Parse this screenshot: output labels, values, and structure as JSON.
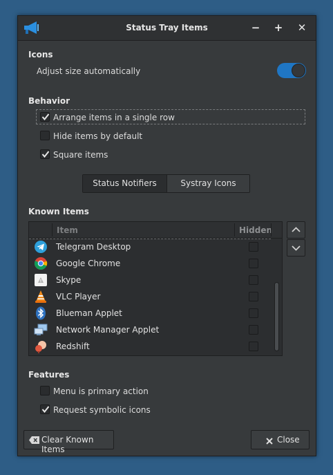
{
  "window": {
    "title": "Status Tray Items",
    "minimize": "−",
    "maximize": "+",
    "close": "✕"
  },
  "icons_section": {
    "label": "Icons",
    "adjust_size_label": "Adjust size automatically",
    "adjust_size_on": true
  },
  "behavior_section": {
    "label": "Behavior",
    "options": [
      {
        "label": "Arrange items in a single row",
        "checked": true
      },
      {
        "label": "Hide items by default",
        "checked": false
      },
      {
        "label": "Square items",
        "checked": true
      }
    ]
  },
  "mode_tabs": {
    "tabs": [
      "Status Notifiers",
      "Systray Icons"
    ],
    "selected": "Status Notifiers"
  },
  "known_items": {
    "label": "Known Items",
    "columns": {
      "item": "Item",
      "hidden": "Hidden"
    },
    "rows": [
      {
        "name": "Telegram Desktop",
        "icon": "telegram-icon",
        "hidden": false
      },
      {
        "name": "Google Chrome",
        "icon": "chrome-icon",
        "hidden": false
      },
      {
        "name": "Skype",
        "icon": "skype-icon",
        "hidden": false
      },
      {
        "name": "VLC Player",
        "icon": "vlc-icon",
        "hidden": false
      },
      {
        "name": "Blueman Applet",
        "icon": "bluetooth-icon",
        "hidden": false
      },
      {
        "name": "Network Manager Applet",
        "icon": "network-icon",
        "hidden": false
      },
      {
        "name": "Redshift",
        "icon": "redshift-icon",
        "hidden": false
      }
    ]
  },
  "features_section": {
    "label": "Features",
    "options": [
      {
        "label": "Menu is primary action",
        "checked": false
      },
      {
        "label": "Request symbolic icons",
        "checked": true
      }
    ]
  },
  "buttons": {
    "clear": "Clear Known Items",
    "close": "Close"
  },
  "colors": {
    "accent": "#1f76c4",
    "window_bg": "#373a3c",
    "desktop_bg": "#2e5d86"
  }
}
